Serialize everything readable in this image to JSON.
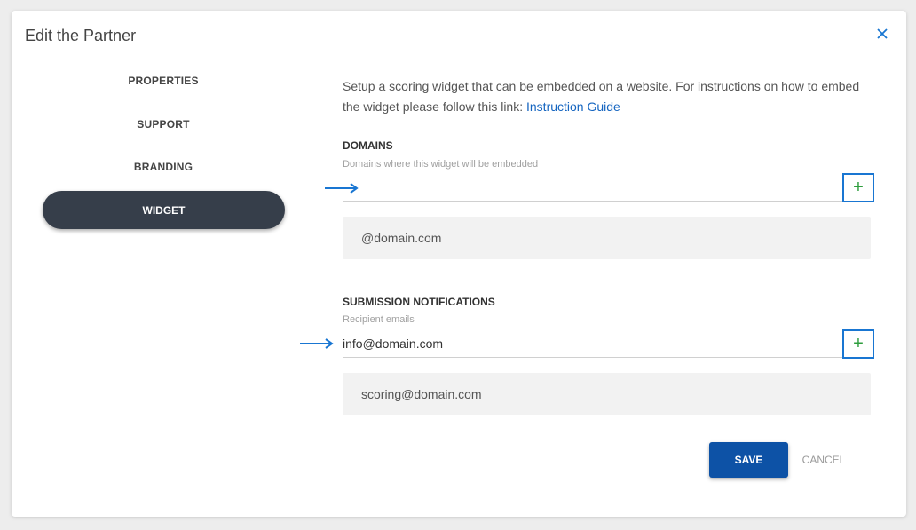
{
  "modal": {
    "title": "Edit the Partner",
    "close_icon": "close-icon"
  },
  "nav": {
    "items": [
      {
        "label": "PROPERTIES"
      },
      {
        "label": "SUPPORT"
      },
      {
        "label": "BRANDING"
      },
      {
        "label": "WIDGET",
        "active": true
      }
    ]
  },
  "intro": {
    "text": "Setup a scoring widget that can be embedded on a website. For instructions on how to embed the widget please follow this link: ",
    "link_label": "Instruction Guide"
  },
  "domains": {
    "title": "DOMAINS",
    "subtitle": "Domains where this widget will be embedded",
    "input_value": "",
    "add_icon": "plus-icon",
    "entries": [
      "@domain.com"
    ]
  },
  "notifications": {
    "title": "SUBMISSION NOTIFICATIONS",
    "subtitle": "Recipient emails",
    "input_value": "info@domain.com",
    "add_icon": "plus-icon",
    "entries": [
      "scoring@domain.com"
    ]
  },
  "actions": {
    "save_label": "SAVE",
    "cancel_label": "CANCEL"
  },
  "colors": {
    "active_nav": "#363e4a",
    "save_button": "#0d52a6",
    "link": "#1565c0",
    "annotation_arrow": "#1976d2",
    "plus": "#2e9e3e"
  }
}
